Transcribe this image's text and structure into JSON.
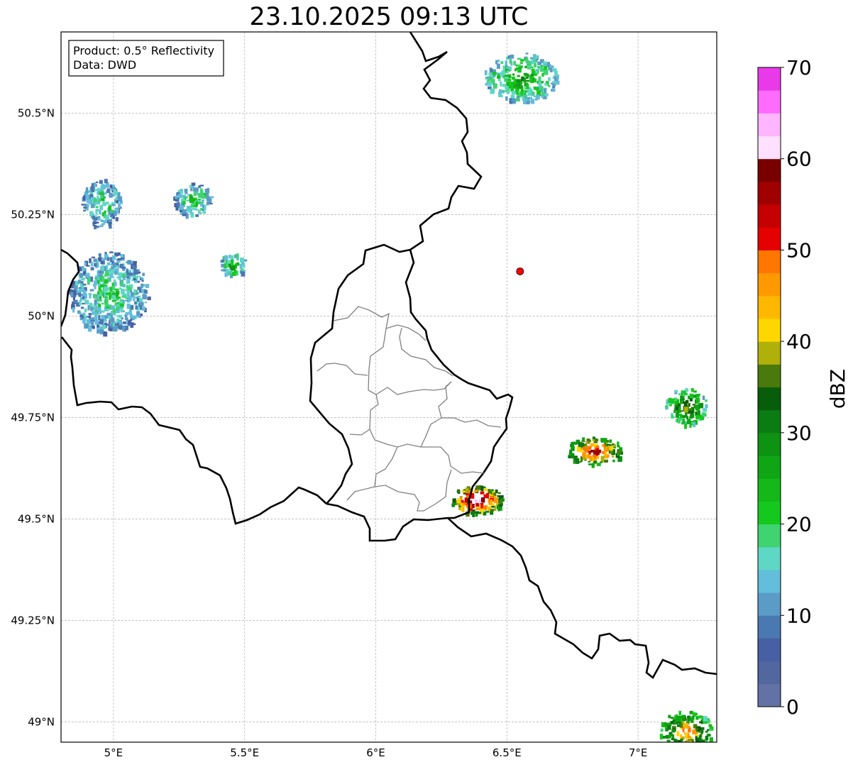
{
  "title": "23.10.2025 09:13 UTC",
  "info_box": {
    "line1": "Product: 0.5° Reflectivity",
    "line2": "Data: DWD"
  },
  "map": {
    "lon_range": [
      4.8,
      7.3
    ],
    "lat_range": [
      48.95,
      50.7
    ],
    "lon_ticks": [
      {
        "v": 5.0,
        "label": "5°E"
      },
      {
        "v": 5.5,
        "label": "5.5°E"
      },
      {
        "v": 6.0,
        "label": "6°E"
      },
      {
        "v": 6.5,
        "label": "6.5°E"
      },
      {
        "v": 7.0,
        "label": "7°E"
      }
    ],
    "lat_ticks": [
      {
        "v": 49.0,
        "label": "49°N"
      },
      {
        "v": 49.25,
        "label": "49.25°N"
      },
      {
        "v": 49.5,
        "label": "49.5°N"
      },
      {
        "v": 49.75,
        "label": "49.75°N"
      },
      {
        "v": 50.0,
        "label": "50°N"
      },
      {
        "v": 50.25,
        "label": "50.25°N"
      },
      {
        "v": 50.5,
        "label": "50.5°N"
      }
    ],
    "radar_site": {
      "lon": 6.55,
      "lat": 50.11,
      "color": "#ff0000"
    },
    "border_color": "#000000",
    "admin_border_color": "#808080",
    "grid": true
  },
  "colorbar": {
    "unit": "dBZ",
    "min": 0,
    "max": 70,
    "ticks": [
      {
        "v": 0,
        "label": "0"
      },
      {
        "v": 10,
        "label": "10"
      },
      {
        "v": 20,
        "label": "20"
      },
      {
        "v": 30,
        "label": "30"
      },
      {
        "v": 40,
        "label": "40"
      },
      {
        "v": 50,
        "label": "50"
      },
      {
        "v": 60,
        "label": "60"
      },
      {
        "v": 70,
        "label": "70"
      }
    ],
    "colors": [
      "#6272a4",
      "#5266a0",
      "#4660a3",
      "#4a78b1",
      "#5a9cc6",
      "#62bedb",
      "#5fd7c5",
      "#3fd470",
      "#15c81e",
      "#14b818",
      "#10a514",
      "#0d9212",
      "#0b7c11",
      "#085d0a",
      "#4a7a0b",
      "#b0b00b",
      "#ffd700",
      "#ffb800",
      "#ff9900",
      "#ff7700",
      "#e50000",
      "#c40000",
      "#a00000",
      "#7a0000",
      "#ffe0ff",
      "#ffb5ff",
      "#ff6bff",
      "#e83ae8"
    ]
  },
  "echo_cells": [
    {
      "id": "nw-cluster-a",
      "lon": 4.98,
      "lat": 50.06,
      "w": 0.3,
      "h": 0.2,
      "level": 9
    },
    {
      "id": "nw-cluster-b",
      "lon": 4.95,
      "lat": 50.28,
      "w": 0.15,
      "h": 0.12,
      "level": 9
    },
    {
      "id": "north-band",
      "lon": 5.3,
      "lat": 50.29,
      "w": 0.15,
      "h": 0.08,
      "level": 10
    },
    {
      "id": "central-patch",
      "lon": 5.45,
      "lat": 50.13,
      "w": 0.1,
      "h": 0.06,
      "level": 12
    },
    {
      "id": "ne-cell",
      "lon": 6.55,
      "lat": 50.59,
      "w": 0.28,
      "h": 0.12,
      "level": 12
    },
    {
      "id": "east-cell",
      "lon": 6.83,
      "lat": 49.67,
      "w": 0.22,
      "h": 0.07,
      "level": 24
    },
    {
      "id": "south-cell",
      "lon": 6.38,
      "lat": 49.55,
      "w": 0.2,
      "h": 0.07,
      "level": 28
    },
    {
      "id": "far-east-cell",
      "lon": 7.18,
      "lat": 49.78,
      "w": 0.16,
      "h": 0.09,
      "level": 16
    },
    {
      "id": "se-corner-cell",
      "lon": 7.18,
      "lat": 48.98,
      "w": 0.2,
      "h": 0.1,
      "level": 20
    }
  ]
}
